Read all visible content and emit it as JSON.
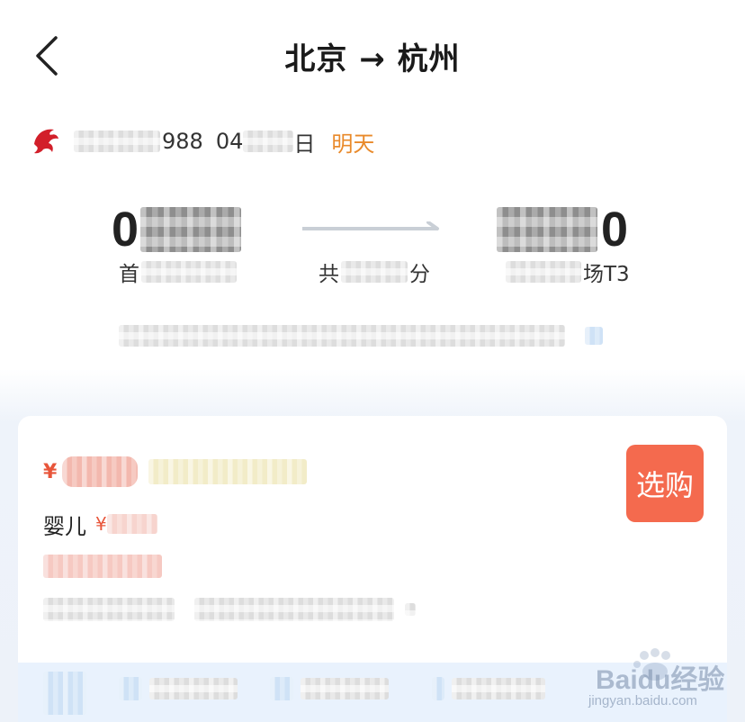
{
  "header": {
    "title": "北京 → 杭州"
  },
  "flight": {
    "flight_number_partial": "988",
    "date_partial": "04",
    "date_suffix": "日",
    "day_tag": "明天",
    "dep_time_partial": "0",
    "arr_time_partial": "0",
    "dep_airport_partial": "首",
    "duration_prefix": "共",
    "duration_suffix": "分",
    "arr_airport_partial": "场T3"
  },
  "cabin": {
    "currency": "¥",
    "infant_label": "婴儿",
    "infant_currency": "¥",
    "buy_label": "选购"
  },
  "watermark": {
    "brand": "Baidu经验",
    "url": "jingyan.baidu.com"
  },
  "colors": {
    "accent_orange": "#e98a2b",
    "buy_button": "#f46a4e",
    "price_red": "#e8553a"
  }
}
